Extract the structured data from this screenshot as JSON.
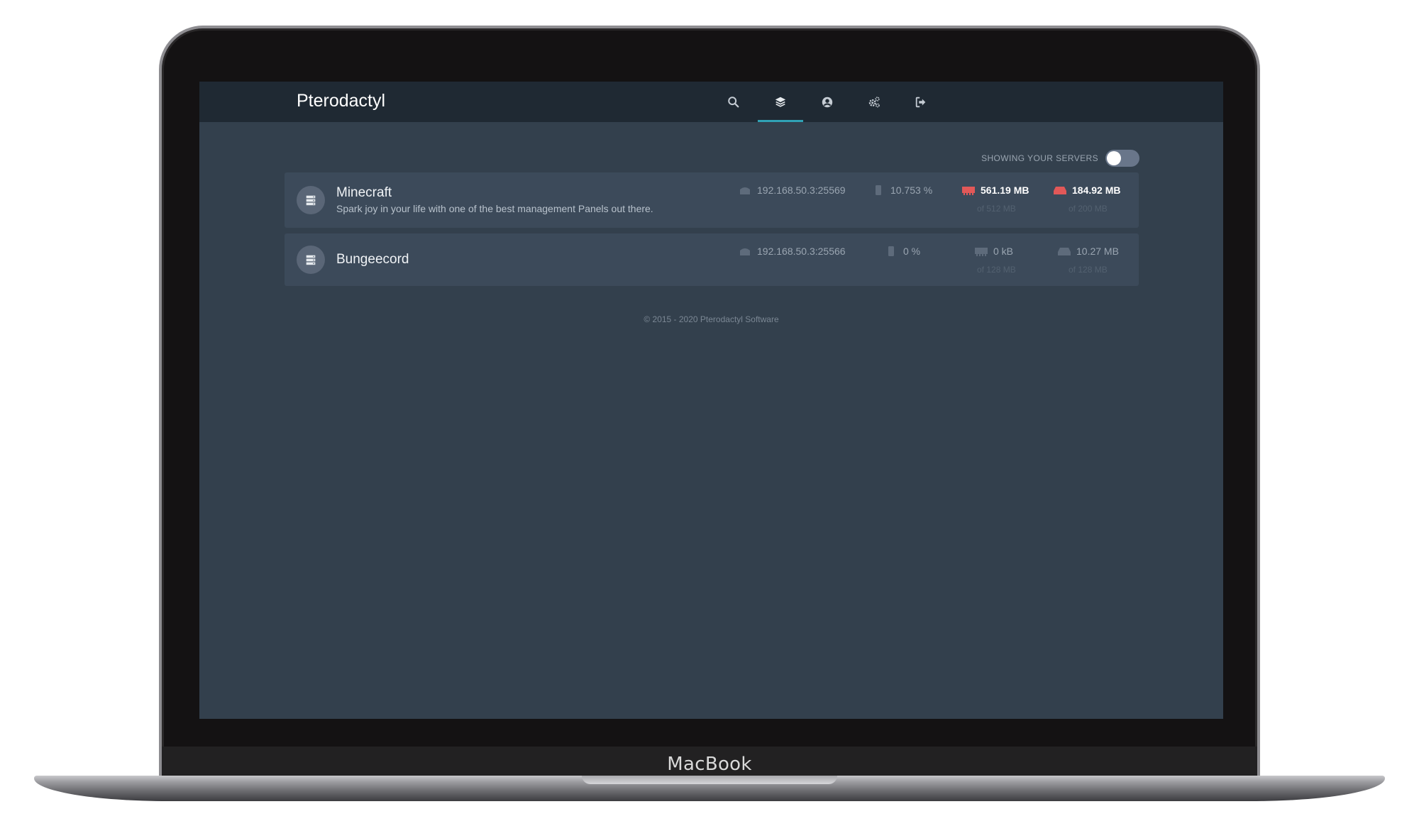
{
  "device": {
    "brand": "MacBook"
  },
  "app": {
    "title": "Pterodactyl"
  },
  "nav": {
    "items": [
      {
        "icon": "search-icon"
      },
      {
        "icon": "layers-icon",
        "active": true
      },
      {
        "icon": "user-circle-icon"
      },
      {
        "icon": "cogs-icon"
      },
      {
        "icon": "sign-out-icon"
      }
    ],
    "accent": "#30a2b5"
  },
  "filter": {
    "label": "SHOWING YOUR SERVERS",
    "enabled": false
  },
  "servers": [
    {
      "name": "Minecraft",
      "description": "Spark joy in your life with one of the best management Panels out there.",
      "address": "192.168.50.3:25569",
      "cpu": "10.753 %",
      "memory": "561.19 MB",
      "memory_limit": "of 512 MB",
      "disk": "184.92 MB",
      "disk_limit": "of 200 MB",
      "alert_color": "#e25858"
    },
    {
      "name": "Bungeecord",
      "description": "",
      "address": "192.168.50.3:25566",
      "cpu": "0 %",
      "memory": "0 kB",
      "memory_limit": "of 128 MB",
      "disk": "10.27 MB",
      "disk_limit": "of 128 MB"
    }
  ],
  "footer": {
    "text": "© 2015 - 2020 Pterodactyl Software"
  }
}
